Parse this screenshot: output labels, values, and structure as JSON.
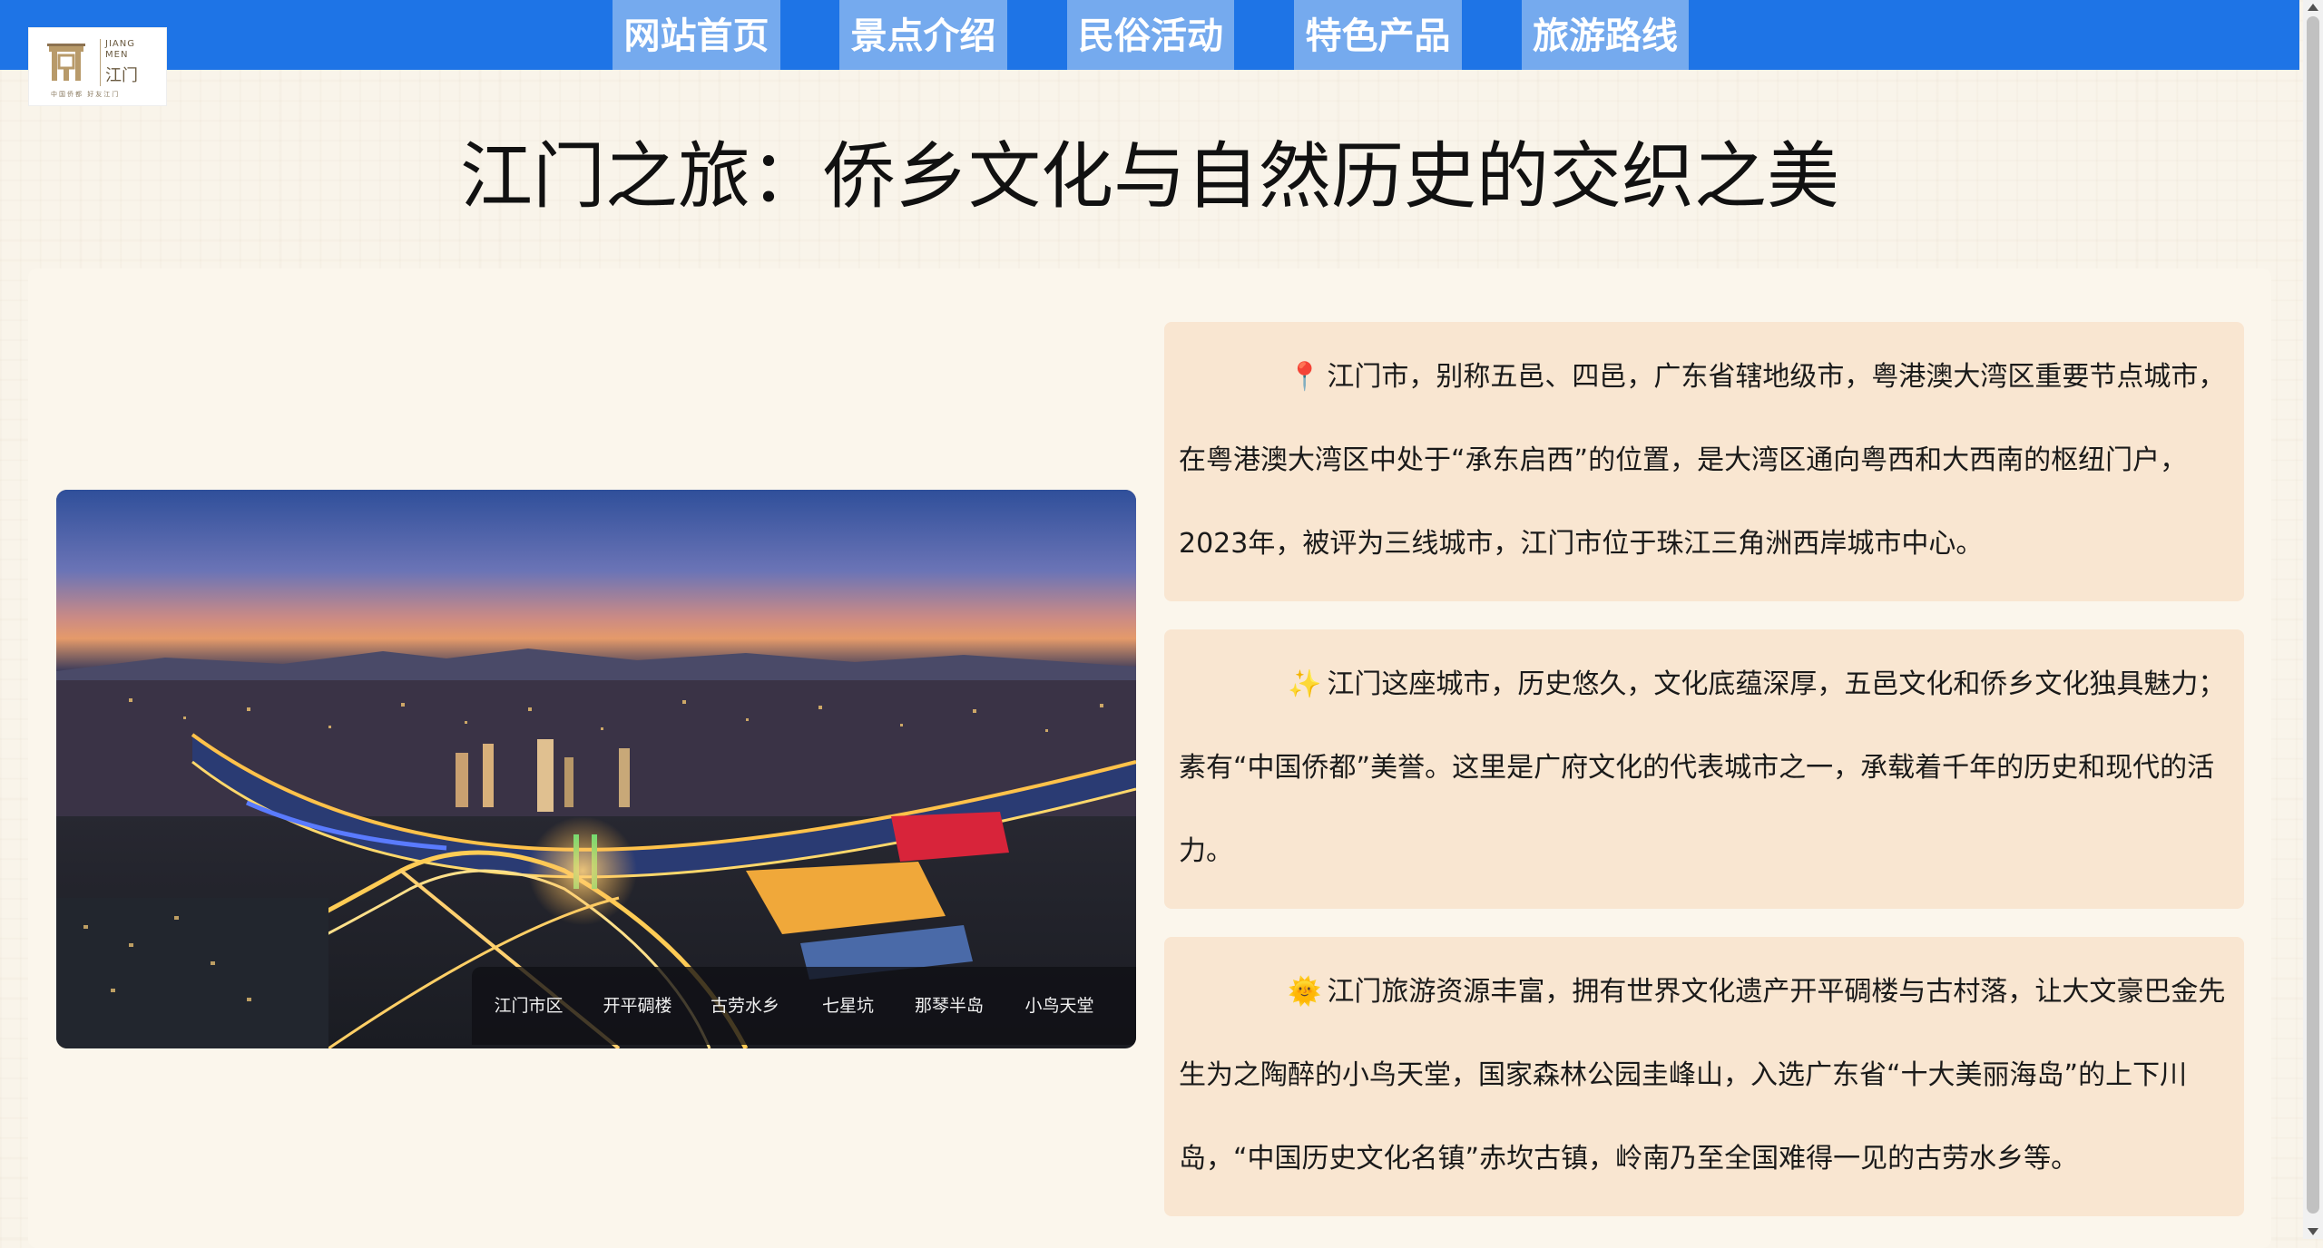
{
  "logo": {
    "en_line1": "JIANG",
    "en_line2": "MEN",
    "zh": "江门",
    "tagline": "中国侨都 好友江门"
  },
  "nav": {
    "items": [
      {
        "label": "网站首页"
      },
      {
        "label": "景点介绍"
      },
      {
        "label": "民俗活动"
      },
      {
        "label": "特色产品"
      },
      {
        "label": "旅游路线"
      }
    ]
  },
  "page": {
    "title": "江门之旅：侨乡文化与自然历史的交织之美"
  },
  "carousel": {
    "tabs": [
      "江门市区",
      "开平碉楼",
      "古劳水乡",
      "七星坑",
      "那琴半岛",
      "小鸟天堂"
    ]
  },
  "info": [
    {
      "emoji": "📍",
      "text": "江门市，别称五邑、四邑，广东省辖地级市，粤港澳大湾区重要节点城市，在粤港澳大湾区中处于“承东启西”的位置，是大湾区通向粤西和大西南的枢纽门户，2023年，被评为三线城市，江门市位于珠江三角洲西岸城市中心。"
    },
    {
      "emoji": "✨",
      "text": "江门这座城市，历史悠久，文化底蕴深厚，五邑文化和侨乡文化独具魅力；素有“中国侨都”美誉。这里是广府文化的代表城市之一，承载着千年的历史和现代的活力。"
    },
    {
      "emoji": "🌞",
      "text": "江门旅游资源丰富，拥有世界文化遗产开平碉楼与古村落，让大文豪巴金先生为之陶醉的小鸟天堂，国家森林公园圭峰山，入选广东省“十大美丽海岛”的上下川岛，“中国历史文化名镇”赤坎古镇，岭南乃至全国难得一见的古劳水乡等。"
    }
  ],
  "colors": {
    "nav_bar": "#1e74e6",
    "nav_button": "#75aaee",
    "card": "#f9e6d1",
    "page_bg": "#f9f4ea"
  }
}
